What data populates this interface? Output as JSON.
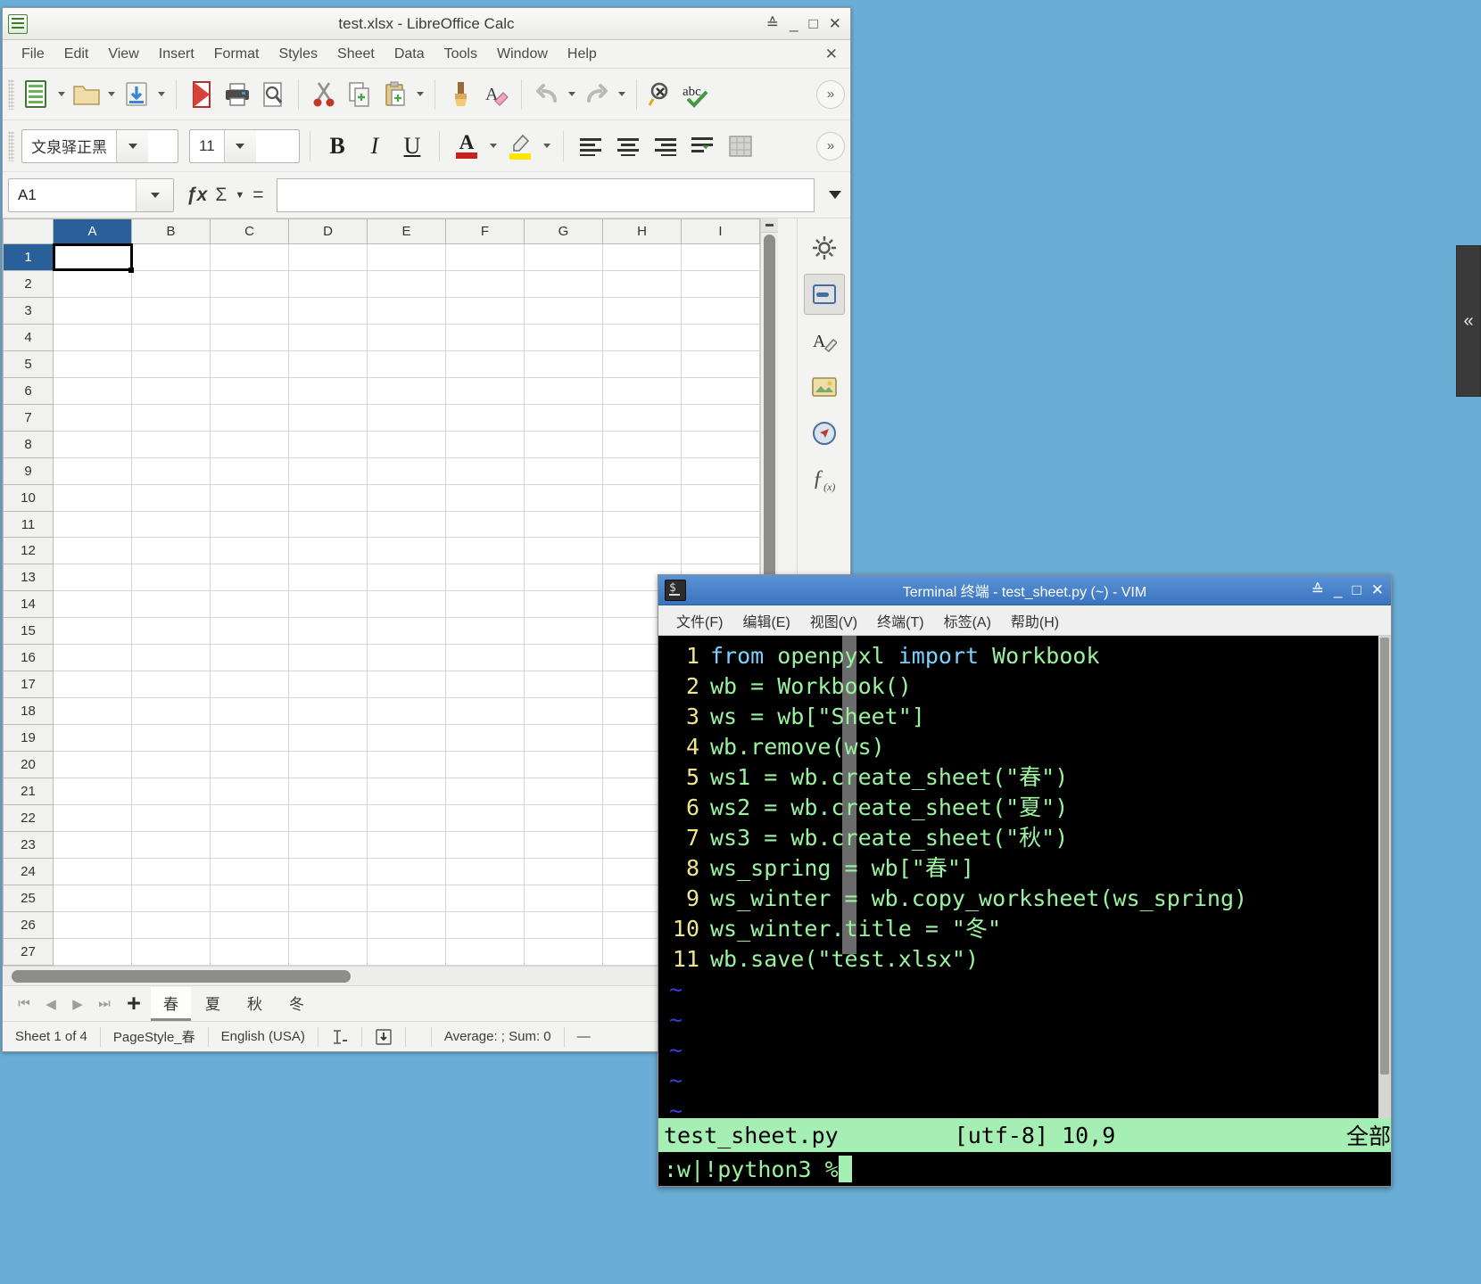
{
  "calc": {
    "title": "test.xlsx - LibreOffice Calc",
    "window_buttons": {
      "minimize": "_",
      "maximize": "□",
      "close": "✕",
      "shade": "≙"
    },
    "menu": [
      "File",
      "Edit",
      "View",
      "Insert",
      "Format",
      "Styles",
      "Sheet",
      "Data",
      "Tools",
      "Window",
      "Help"
    ],
    "close_document": "✕",
    "toolbar_icons": [
      "new-document-icon",
      "open-file-icon",
      "save-icon",
      "export-pdf-icon",
      "print-icon",
      "print-preview-icon",
      "cut-icon",
      "copy-icon",
      "paste-icon",
      "clone-formatting-icon",
      "clear-formatting-icon",
      "undo-icon",
      "redo-icon",
      "find-replace-icon",
      "spelling-icon"
    ],
    "toolbar_expand": "»",
    "font_name": "文泉驿正黑",
    "font_size": "11",
    "format_icons": [
      "bold-icon",
      "italic-icon",
      "underline-icon",
      "font-color-icon",
      "highlight-color-icon",
      "align-left-icon",
      "align-center-icon",
      "align-right-icon",
      "wrap-text-icon",
      "borders-icon"
    ],
    "format_bold": "B",
    "format_italic": "I",
    "format_underline": "U",
    "format_fontcolor": "A",
    "name_box": "A1",
    "formula_fx": "ƒx",
    "formula_sum": "Σ",
    "formula_equals": "=",
    "input_line": "",
    "columns": [
      "A",
      "B",
      "C",
      "D",
      "E",
      "F",
      "G",
      "H",
      "I"
    ],
    "rows": [
      "1",
      "2",
      "3",
      "4",
      "5",
      "6",
      "7",
      "8",
      "9",
      "10",
      "11",
      "12",
      "13",
      "14",
      "15",
      "16",
      "17",
      "18",
      "19",
      "20",
      "21",
      "22",
      "23",
      "24",
      "25",
      "26",
      "27"
    ],
    "active_cell": "A1",
    "sidebar_icons": [
      "sidebar-settings-icon",
      "properties-icon",
      "styles-icon",
      "gallery-icon",
      "navigator-icon",
      "functions-icon"
    ],
    "sidebar_glyphs": [
      "⚙",
      "▤",
      "A",
      "▣",
      "◉",
      "ƒ"
    ],
    "sheet_nav": [
      "⏮",
      "◀",
      "▶",
      "⏭"
    ],
    "add_sheet": "+",
    "sheet_tabs": [
      "春",
      "夏",
      "秋",
      "冬"
    ],
    "active_sheet_index": 0,
    "status": {
      "sheet_count": "Sheet 1 of 4",
      "page_style": "PageStyle_春",
      "language": "English (USA)",
      "insert_mode": "selection-mode-icon",
      "save_state": "unsaved-changes-icon",
      "selection": "Average: ; Sum: 0",
      "zoom_slider": "—"
    }
  },
  "edge_panel": {
    "handle": "«"
  },
  "terminal": {
    "title": "Terminal 终端 - test_sheet.py (~) - VIM",
    "window_buttons": {
      "shade": "≙",
      "minimize": "_",
      "maximize": "□",
      "close": "✕"
    },
    "menu": [
      "文件(F)",
      "编辑(E)",
      "视图(V)",
      "终端(T)",
      "标签(A)",
      "帮助(H)"
    ],
    "vim": {
      "lines": [
        {
          "n": "1",
          "text": "from openpyxl import Workbook"
        },
        {
          "n": "2",
          "text": "wb = Workbook()"
        },
        {
          "n": "3",
          "text": "ws = wb[\"Sheet\"]"
        },
        {
          "n": "4",
          "text": "wb.remove(ws)"
        },
        {
          "n": "5",
          "text": "ws1 = wb.create_sheet(\"春\")"
        },
        {
          "n": "6",
          "text": "ws2 = wb.create_sheet(\"夏\")"
        },
        {
          "n": "7",
          "text": "ws3 = wb.create_sheet(\"秋\")"
        },
        {
          "n": "8",
          "text": "ws_spring = wb[\"春\"]"
        },
        {
          "n": "9",
          "text": "ws_winter = wb.copy_worksheet(ws_spring)"
        },
        {
          "n": "10",
          "text": "ws_winter.title = \"冬\""
        },
        {
          "n": "11",
          "text": "wb.save(\"test.xlsx\")"
        }
      ],
      "empty_markers": [
        "~",
        "~",
        "~",
        "~",
        "~"
      ],
      "status_file": "test_sheet.py",
      "status_encoding": "[utf-8]",
      "status_position": "10,9",
      "status_scroll": "全部",
      "command_line": ":w|!python3 %"
    }
  }
}
